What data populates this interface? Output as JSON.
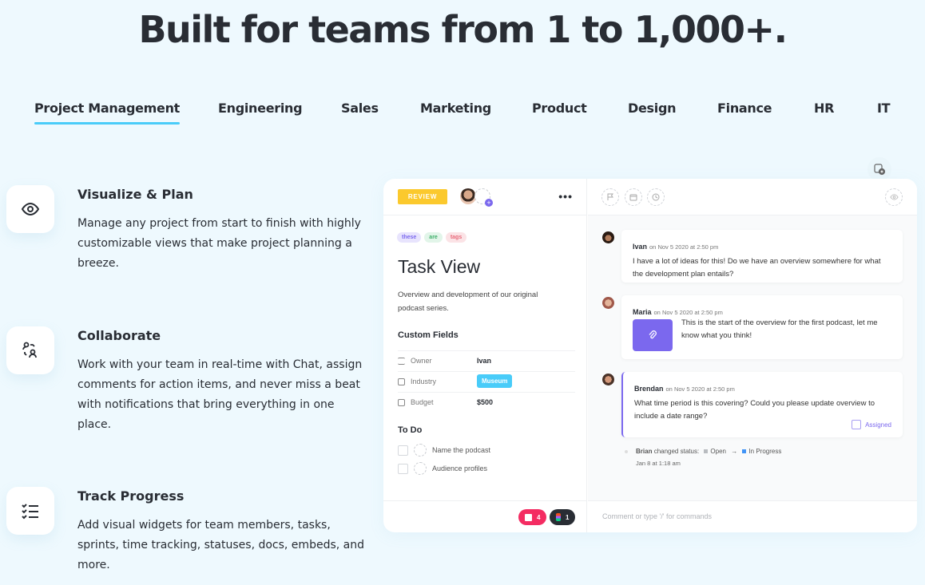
{
  "headline": "Built for teams from 1 to 1,000+.",
  "tabs": [
    {
      "label": "Project Management",
      "active": true
    },
    {
      "label": "Engineering"
    },
    {
      "label": "Sales"
    },
    {
      "label": "Marketing"
    },
    {
      "label": "Product"
    },
    {
      "label": "Design"
    },
    {
      "label": "Finance"
    },
    {
      "label": "HR"
    },
    {
      "label": "IT"
    }
  ],
  "features": [
    {
      "icon": "eye-icon",
      "title": "Visualize & Plan",
      "description": "Manage any project from start to finish with highly customizable views that make project planning a breeze."
    },
    {
      "icon": "users-collaborate-icon",
      "title": "Collaborate",
      "description": "Work with your team in real-time with Chat, assign comments for action items, and never miss a beat with notifications that bring everything in one place."
    },
    {
      "icon": "checklist-icon",
      "title": "Track Progress",
      "description": "Add visual widgets for team members, tasks, sprints, time tracking, statuses, docs, embeds, and more."
    }
  ],
  "task": {
    "status": "REVIEW",
    "tags": [
      {
        "label": "these",
        "color": "#7b68ee",
        "bg": "#e8e4fd"
      },
      {
        "label": "are",
        "color": "#3fae6a",
        "bg": "#e2f5e9"
      },
      {
        "label": "tags",
        "color": "#e86a7a",
        "bg": "#fbe3e6"
      }
    ],
    "title": "Task View",
    "description": "Overview and development of our original podcast series.",
    "custom_fields_title": "Custom Fields",
    "custom_fields": [
      {
        "label": "Owner",
        "value": "Ivan"
      },
      {
        "label": "Industry",
        "value": "Museum"
      },
      {
        "label": "Budget",
        "value": "$500"
      }
    ],
    "todo_title": "To Do",
    "todos": [
      "Name the podcast",
      "Audience profiles"
    ],
    "attachments": [
      {
        "icon": "image-icon",
        "count": "4",
        "color": "#f42c62"
      },
      {
        "icon": "figma-icon",
        "count": "1",
        "color": "#292d34"
      }
    ]
  },
  "activity": {
    "comments": [
      {
        "name": "Ivan",
        "time": "on Nov 5 2020 at 2:50 pm",
        "text": "I have a lot of ideas for this! Do we have an overview somewhere for what the development plan entails?"
      },
      {
        "name": "Maria",
        "time": "on Nov 5 2020 at 2:50 pm",
        "text": "This is the start of the overview for the first podcast, let me know what you think!"
      },
      {
        "name": "Brendan",
        "time": "on Nov 5 2020 at 2:50 pm",
        "text": "What time period is this covering? Could you please update overview to include a date range?",
        "assigned_label": "Assigned"
      }
    ],
    "status_change": {
      "user": "Brian",
      "action": "changed status:",
      "from": "Open",
      "to": "In Progress",
      "time": "Jan 8 at 1:18 am"
    },
    "comment_placeholder": "Comment or type '/' for commands"
  },
  "colors": {
    "accent": "#49ccf9",
    "purple": "#7b68ee",
    "review": "#fbc92d"
  }
}
